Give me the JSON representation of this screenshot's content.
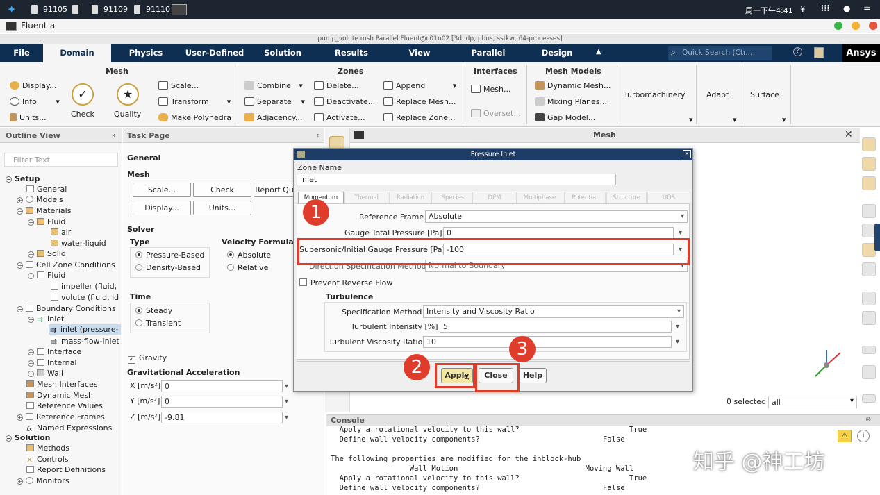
{
  "taskbar": {
    "items": [
      "91105",
      "91109",
      "91110"
    ],
    "clock": "周一下午4:41"
  },
  "app": {
    "title": "Fluent-a"
  },
  "window_title": "pump_volute.msh Parallel Fluent@c01n02  [3d, dp, pbns, sstkw, 64-processes]",
  "ribbon_tabs": [
    "File",
    "Domain",
    "Physics",
    "User-Defined",
    "Solution",
    "Results",
    "View",
    "Parallel",
    "Design"
  ],
  "search": {
    "placeholder": "Quick Search (Ctr..."
  },
  "brand": "Ansys",
  "ribbon": {
    "mesh": {
      "title": "Mesh",
      "display": "Display...",
      "info": "Info",
      "units": "Units...",
      "check": "Check",
      "quality": "Quality",
      "scale": "Scale...",
      "transform": "Transform",
      "make_polyhedra": "Make Polyhedra"
    },
    "zones": {
      "title": "Zones",
      "combine": "Combine",
      "separate": "Separate",
      "adjacency": "Adjacency...",
      "delete": "Delete...",
      "deactivate": "Deactivate...",
      "activate": "Activate...",
      "append": "Append",
      "replace_mesh": "Replace Mesh...",
      "replace_zone": "Replace Zone..."
    },
    "interfaces": {
      "title": "Interfaces",
      "mesh": "Mesh...",
      "overset": "Overset..."
    },
    "mesh_models": {
      "title": "Mesh Models",
      "dynamic_mesh": "Dynamic Mesh...",
      "mixing_planes": "Mixing Planes...",
      "gap_model": "Gap Model..."
    },
    "turbomachinery": "Turbomachinery",
    "adapt": "Adapt",
    "surface": "Surface"
  },
  "outline": {
    "title": "Outline View",
    "filter_placeholder": "Filter Text",
    "items": [
      "Setup",
      "General",
      "Models",
      "Materials",
      "Fluid",
      "air",
      "water-liquid",
      "Solid",
      "Cell Zone Conditions",
      "Fluid",
      "impeller (fluid,",
      "volute (fluid, id",
      "Boundary Conditions",
      "Inlet",
      "inlet (pressure-",
      "mass-flow-inlet",
      "Interface",
      "Internal",
      "Wall",
      "Mesh Interfaces",
      "Dynamic Mesh",
      "Reference Values",
      "Reference Frames",
      "Named Expressions",
      "Solution",
      "Methods",
      "Controls",
      "Report Definitions",
      "Monitors"
    ]
  },
  "task": {
    "title": "Task Page",
    "general": "General",
    "mesh": "Mesh",
    "scale": "Scale...",
    "check": "Check",
    "report_quality": "Report Qu",
    "display": "Display...",
    "units": "Units...",
    "solver": "Solver",
    "type": "Type",
    "pressure_based": "Pressure-Based",
    "density_based": "Density-Based",
    "velocity_formulation": "Velocity Formulat",
    "absolute": "Absolute",
    "relative": "Relative",
    "time": "Time",
    "steady": "Steady",
    "transient": "Transient",
    "gravity": "Gravity",
    "grav_acc": "Gravitational Acceleration",
    "x_label": "X [m/s²]",
    "x_value": "0",
    "y_label": "Y [m/s²]",
    "y_value": "0",
    "z_label": "Z [m/s²]",
    "z_value": "-9.81"
  },
  "graphics": {
    "title": "Mesh",
    "selected": "0 selected",
    "filter": "all"
  },
  "console": {
    "title": "Console",
    "lines": [
      "  Apply a rotational velocity to this wall?                         True",
      "  Define wall velocity components?                            False",
      "",
      "The following properties are modified for the inblock-hub",
      "                  Wall Motion                             Moving Wall",
      "  Apply a rotational velocity to this wall?                         True",
      "  Define wall velocity components?                            False"
    ]
  },
  "dialog": {
    "title": "Pressure Inlet",
    "zone_name_label": "Zone Name",
    "zone_name": "inlet",
    "tabs": [
      "Momentum",
      "Thermal",
      "Radiation",
      "Species",
      "DPM",
      "Multiphase",
      "Potential",
      "Structure",
      "UDS"
    ],
    "reference_frame_label": "Reference Frame",
    "reference_frame": "Absolute",
    "gauge_total_label": "Gauge Total Pressure [Pa]",
    "gauge_total": "0",
    "supersonic_label": "Supersonic/Initial Gauge Pressure [Pa]",
    "supersonic": "-100",
    "direction_label": "Direction Specification Method",
    "direction": "Normal to Boundary",
    "prevent_reverse": "Prevent Reverse Flow",
    "turbulence": "Turbulence",
    "spec_method_label": "Specification Method",
    "spec_method": "Intensity and Viscosity Ratio",
    "intensity_label": "Turbulent Intensity [%]",
    "intensity": "5",
    "viscosity_label": "Turbulent Viscosity Ratio",
    "viscosity": "10",
    "apply": "Apply",
    "close": "Close",
    "help": "Help"
  },
  "annotations": [
    "1",
    "2",
    "3"
  ],
  "watermark": "知乎 @神工坊",
  "colors": {
    "ribbon_bg": "#0f2f52",
    "annotation_red": "#e03c2c",
    "dialog_title": "#1e3d66"
  }
}
